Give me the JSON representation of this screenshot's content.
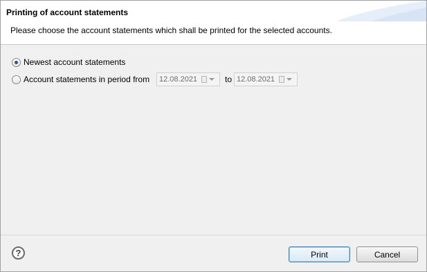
{
  "dialog": {
    "title": "Printing of account statements",
    "description": "Please choose the account statements which shall be printed for the selected accounts."
  },
  "options": {
    "newest_label": "Newest account statements",
    "newest_selected": true,
    "period_label": "Account statements in period from",
    "period_selected": false,
    "from_date": "12.08.2021",
    "to_label": "to",
    "to_date": "12.08.2021"
  },
  "footer": {
    "help_glyph": "?",
    "print_label": "Print",
    "cancel_label": "Cancel"
  }
}
